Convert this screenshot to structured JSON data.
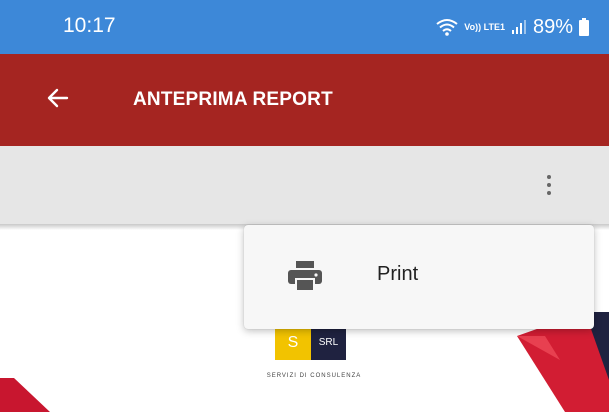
{
  "status_bar": {
    "time": "10:17",
    "network_label": "Vo)) LTE1",
    "battery": "89%"
  },
  "app_bar": {
    "title": "ANTEPRIMA REPORT",
    "back_icon": "arrow-left-icon"
  },
  "toolbar": {
    "more_icon": "more-vert-icon"
  },
  "menu": {
    "items": [
      {
        "label": "Print",
        "icon": "printer-icon"
      }
    ]
  },
  "document": {
    "logo_left": "S",
    "logo_right": "SRL",
    "logo_caption": "SERVIZI DI CONSULENZA"
  },
  "colors": {
    "status_bar": "#3d88d8",
    "app_bar": "#a52521",
    "toolbar": "#e6e6e6",
    "logo_yellow": "#f2c300",
    "logo_navy": "#1f2240"
  }
}
